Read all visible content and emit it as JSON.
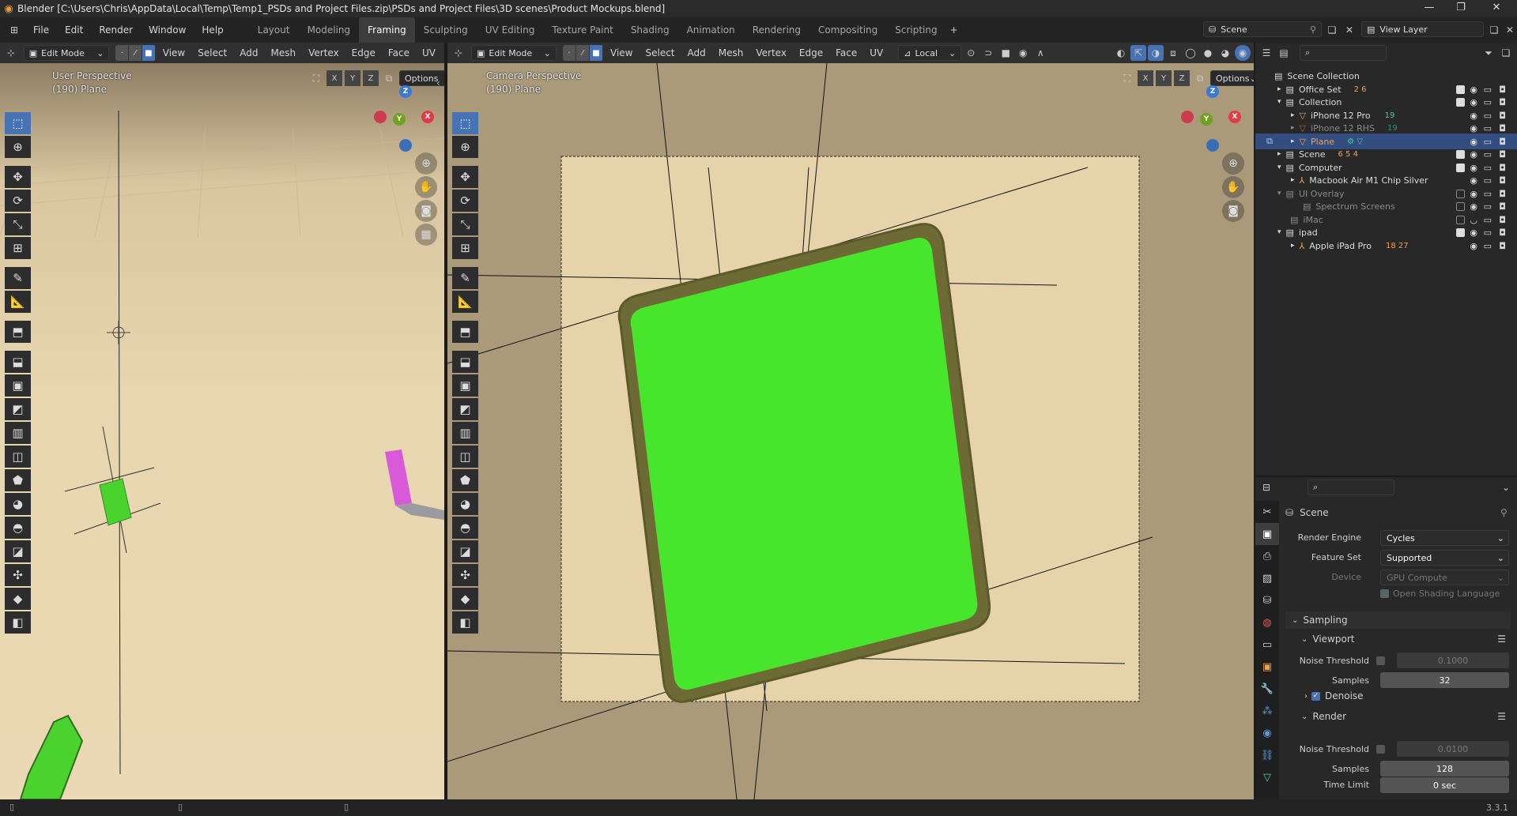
{
  "window": {
    "title": "Blender [C:\\Users\\Chris\\AppData\\Local\\Temp\\Temp1_PSDs and Project Files.zip\\PSDs and Project Files\\3D scenes\\Product Mockups.blend]"
  },
  "menus": [
    "File",
    "Edit",
    "Render",
    "Window",
    "Help"
  ],
  "workspaces": [
    "Layout",
    "Modeling",
    "Framing",
    "Sculpting",
    "UV Editing",
    "Texture Paint",
    "Shading",
    "Animation",
    "Rendering",
    "Compositing",
    "Scripting"
  ],
  "active_workspace": "Framing",
  "top_right": {
    "scene": "Scene",
    "view_layer": "View Layer"
  },
  "viewport_left": {
    "mode": "Edit Mode",
    "menus": [
      "View",
      "Select",
      "Add",
      "Mesh",
      "Vertex",
      "Edge",
      "Face",
      "UV"
    ],
    "axes": [
      "X",
      "Y",
      "Z"
    ],
    "options": "Options",
    "overlay_line1": "User Perspective",
    "overlay_line2": "(190) Plane"
  },
  "viewport_right": {
    "mode": "Edit Mode",
    "menus": [
      "View",
      "Select",
      "Add",
      "Mesh",
      "Vertex",
      "Edge",
      "Face",
      "UV"
    ],
    "orientation": "Local",
    "axes": [
      "X",
      "Y",
      "Z"
    ],
    "options": "Options",
    "overlay_line1": "Camera Perspective",
    "overlay_line2": "(190) Plane"
  },
  "outliner": {
    "search_placeholder": "",
    "rows": [
      {
        "label": "Scene Collection",
        "badge": ""
      },
      {
        "label": "Office Set",
        "badge": "2 6"
      },
      {
        "label": "Collection",
        "badge": ""
      },
      {
        "label": "iPhone 12 Pro",
        "badge": "19"
      },
      {
        "label": "iPhone 12 RHS",
        "badge": "19"
      },
      {
        "label": "Plane",
        "badge": ""
      },
      {
        "label": "Scene",
        "badge": "6 5 4"
      },
      {
        "label": "Computer",
        "badge": ""
      },
      {
        "label": "Macbook Air M1 Chip Silver",
        "badge": ""
      },
      {
        "label": "UI Overlay",
        "badge": ""
      },
      {
        "label": "Spectrum Screens",
        "badge": ""
      },
      {
        "label": "iMac",
        "badge": ""
      },
      {
        "label": "ipad",
        "badge": ""
      },
      {
        "label": "Apple iPad Pro",
        "badge": "18 27"
      }
    ]
  },
  "properties": {
    "context": "Scene",
    "render_engine_label": "Render Engine",
    "render_engine": "Cycles",
    "feature_set_label": "Feature Set",
    "feature_set": "Supported",
    "device_label": "Device",
    "device": "GPU Compute",
    "osl_label": "Open Shading Language",
    "sampling": "Sampling",
    "viewport": "Viewport",
    "vp_noise_label": "Noise Threshold",
    "vp_noise": "0.1000",
    "vp_samples_label": "Samples",
    "vp_samples": "32",
    "denoise": "Denoise",
    "render": "Render",
    "r_noise_label": "Noise Threshold",
    "r_noise": "0.0100",
    "r_samples_label": "Samples",
    "r_samples": "128",
    "time_limit_label": "Time Limit",
    "time_limit": "0 sec"
  },
  "status": {
    "version": "3.3.1"
  },
  "colors": {
    "accent": "#4772b3",
    "screen_green": "#47e62d",
    "bg_cream": "#e6d3aa"
  }
}
